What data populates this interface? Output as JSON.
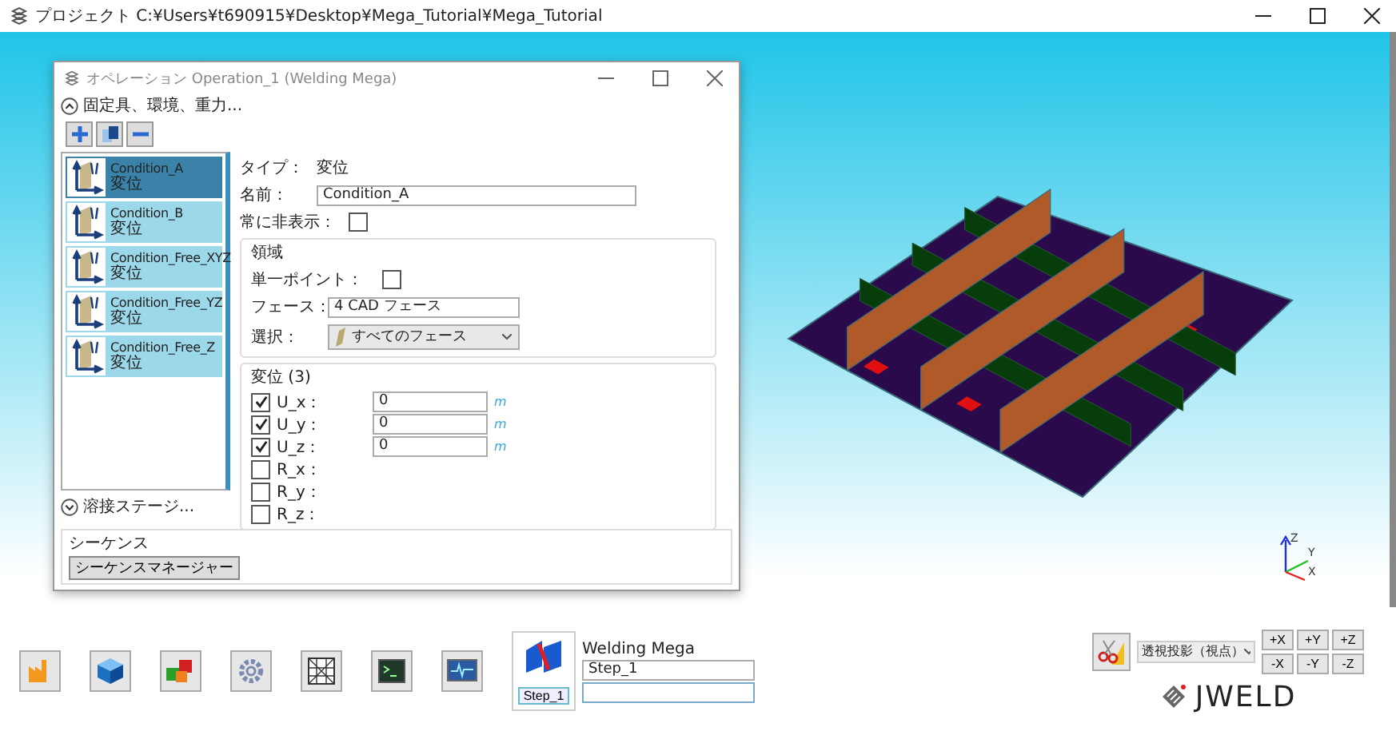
{
  "window": {
    "title": "プロジェクト C:¥Users¥t690915¥Desktop¥Mega_Tutorial¥Mega_Tutorial"
  },
  "dialog": {
    "title": "オペレーション Operation_1 (Welding Mega)",
    "section_1": {
      "label": "固定具、環境、重力...",
      "expanded": true
    },
    "conditions": [
      {
        "name": "Condition_A",
        "type": "変位",
        "selected": true
      },
      {
        "name": "Condition_B",
        "type": "変位",
        "selected": false
      },
      {
        "name": "Condition_Free_XYZ",
        "type": "変位",
        "selected": false
      },
      {
        "name": "Condition_Free_YZ",
        "type": "変位",
        "selected": false
      },
      {
        "name": "Condition_Free_Z",
        "type": "変位",
        "selected": false
      }
    ],
    "properties": {
      "type_label": "タイプ：",
      "type_value": "変位",
      "name_label": "名前：",
      "name_value": "Condition_A",
      "hide_label": "常に非表示：",
      "hide_checked": false
    },
    "region": {
      "title": "領域",
      "single_point_label": "単一ポイント：",
      "single_point_checked": false,
      "face_label": "フェース：",
      "face_value": "4 CAD フェース",
      "select_label": "選択：",
      "select_value": "すべてのフェース"
    },
    "displacement": {
      "title": "変位 (3)",
      "dofs": [
        {
          "label": "U_x：",
          "checked": true,
          "value": "0",
          "unit": "m"
        },
        {
          "label": "U_y：",
          "checked": true,
          "value": "0",
          "unit": "m"
        },
        {
          "label": "U_z：",
          "checked": true,
          "value": "0",
          "unit": "m"
        },
        {
          "label": "R_x：",
          "checked": false
        },
        {
          "label": "R_y：",
          "checked": false
        },
        {
          "label": "R_z：",
          "checked": false
        }
      ]
    },
    "section_2": {
      "label": "溶接ステージ...",
      "expanded": false
    },
    "sequence": {
      "title": "シーケンス",
      "button": "シーケンスマネージャー"
    }
  },
  "viewport": {
    "triad_labels": [
      "Z",
      "Y",
      "X"
    ]
  },
  "toolbar": {
    "step_label": "Step_1",
    "operation_name": "Welding Mega",
    "step_field": "Step_1",
    "projection": "透視投影（視点）",
    "axis_buttons": [
      "+X",
      "+Y",
      "+Z",
      "-X",
      "-Y",
      "-Z"
    ]
  },
  "logo": "JWELD"
}
